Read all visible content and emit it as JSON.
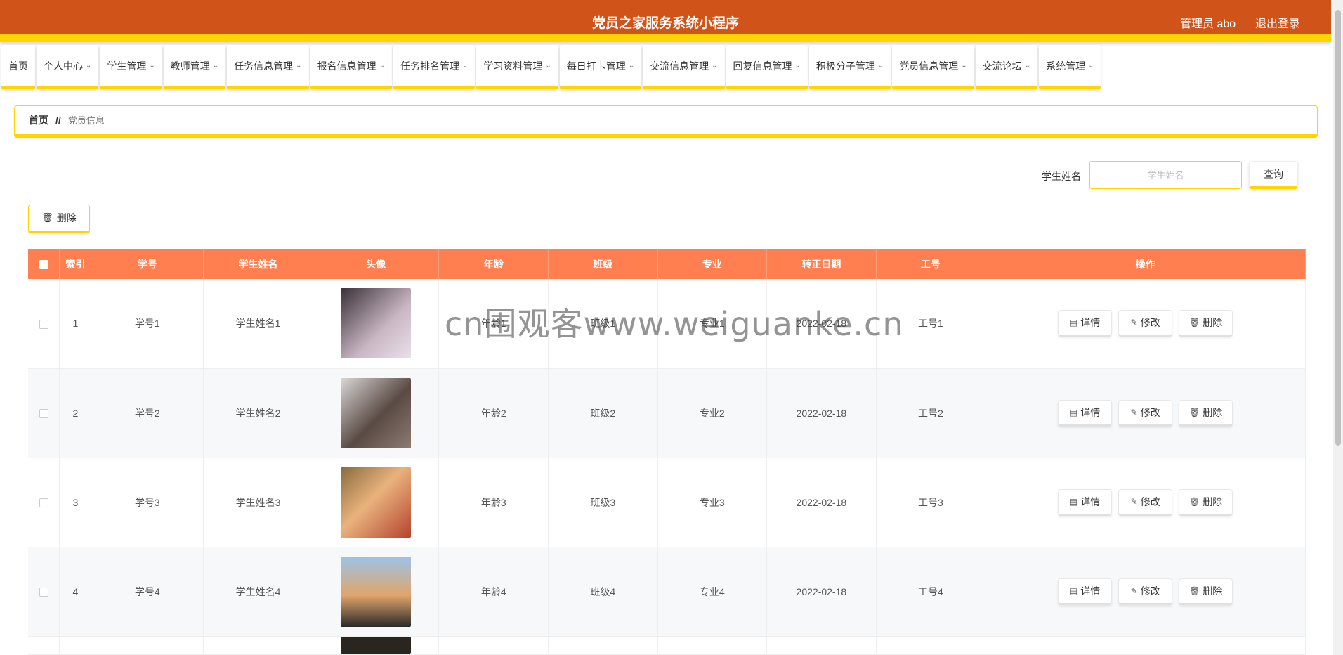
{
  "header": {
    "title": "党员之家服务系统小程序",
    "admin": "管理员 abo",
    "logout": "退出登录"
  },
  "nav": [
    {
      "label": "首页",
      "dropdown": false
    },
    {
      "label": "个人中心",
      "dropdown": true
    },
    {
      "label": "学生管理",
      "dropdown": true
    },
    {
      "label": "教师管理",
      "dropdown": true
    },
    {
      "label": "任务信息管理",
      "dropdown": true
    },
    {
      "label": "报名信息管理",
      "dropdown": true
    },
    {
      "label": "任务排名管理",
      "dropdown": true
    },
    {
      "label": "学习资料管理",
      "dropdown": true
    },
    {
      "label": "每日打卡管理",
      "dropdown": true
    },
    {
      "label": "交流信息管理",
      "dropdown": true
    },
    {
      "label": "回复信息管理",
      "dropdown": true
    },
    {
      "label": "积极分子管理",
      "dropdown": true
    },
    {
      "label": "党员信息管理",
      "dropdown": true
    },
    {
      "label": "交流论坛",
      "dropdown": true
    },
    {
      "label": "系统管理",
      "dropdown": true
    }
  ],
  "breadcrumb": {
    "home": "首页",
    "sep": "//",
    "current": "党员信息"
  },
  "search": {
    "label": "学生姓名",
    "placeholder": "学生姓名",
    "button": "查询"
  },
  "toolbar": {
    "delete": "删除"
  },
  "table": {
    "columns": [
      "索引",
      "学号",
      "学生姓名",
      "头像",
      "年龄",
      "班级",
      "专业",
      "转正日期",
      "工号",
      "操作"
    ],
    "rows": [
      {
        "index": "1",
        "no": "学号1",
        "name": "学生姓名1",
        "age": "年龄1",
        "cls": "班级1",
        "major": "专业1",
        "date": "2022-02-18",
        "job": "工号1"
      },
      {
        "index": "2",
        "no": "学号2",
        "name": "学生姓名2",
        "age": "年龄2",
        "cls": "班级2",
        "major": "专业2",
        "date": "2022-02-18",
        "job": "工号2"
      },
      {
        "index": "3",
        "no": "学号3",
        "name": "学生姓名3",
        "age": "年龄3",
        "cls": "班级3",
        "major": "专业3",
        "date": "2022-02-18",
        "job": "工号3"
      },
      {
        "index": "4",
        "no": "学号4",
        "name": "学生姓名4",
        "age": "年龄4",
        "cls": "班级4",
        "major": "专业4",
        "date": "2022-02-18",
        "job": "工号4"
      }
    ],
    "actions": {
      "detail": "详情",
      "edit": "修改",
      "delete": "删除"
    }
  },
  "watermark": "cn围观客www.weiguanke.cn",
  "colors": {
    "header": "#d0541a",
    "accent": "#ffd500",
    "table_header": "#ff7f50"
  }
}
